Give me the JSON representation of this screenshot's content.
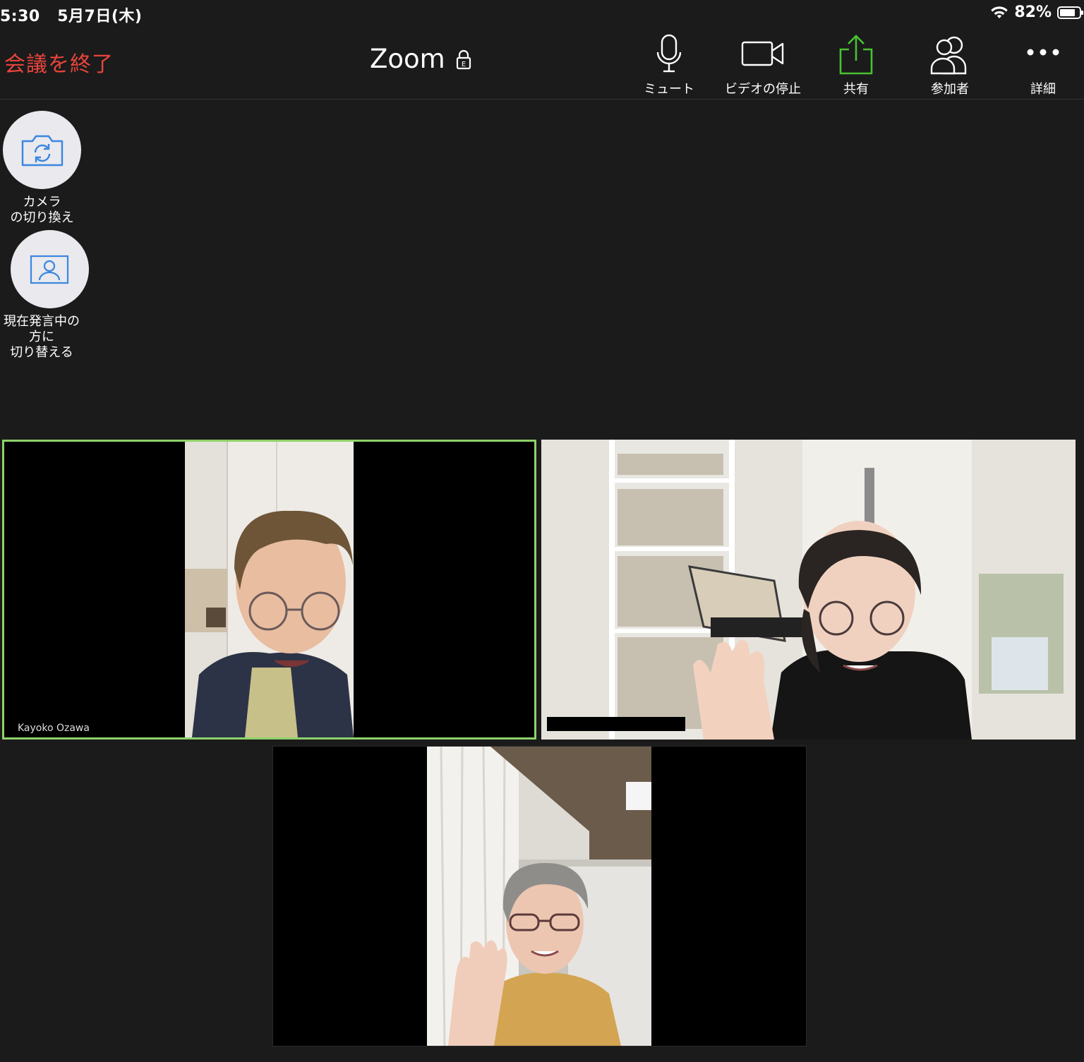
{
  "status": {
    "time": "5:30",
    "date": "5月7日(木)",
    "battery_text": "82%",
    "battery_level": 0.82,
    "wifi_icon": "wifi-icon"
  },
  "toolbar": {
    "end_label": "会議を終了",
    "title": "Zoom",
    "lock_icon": "lock-icon",
    "mute_label": "ミュート",
    "video_label": "ビデオの停止",
    "share_label": "共有",
    "participants_label": "参加者",
    "more_label": "詳細"
  },
  "side": {
    "switch_camera_line1": "カメラ",
    "switch_camera_line2": "の切り換え",
    "speaker_line1": "現在発言中の",
    "speaker_line2": "方に",
    "speaker_line3": "切り替える"
  },
  "participants": [
    {
      "name": "Kayoko Ozawa",
      "active": true
    },
    {
      "name": "",
      "active": false
    },
    {
      "name": "",
      "active": false
    }
  ],
  "colors": {
    "end_red": "#e8453c",
    "share_green": "#49c233",
    "active_border": "#8ed26a",
    "icon_blue": "#3a86e0"
  }
}
